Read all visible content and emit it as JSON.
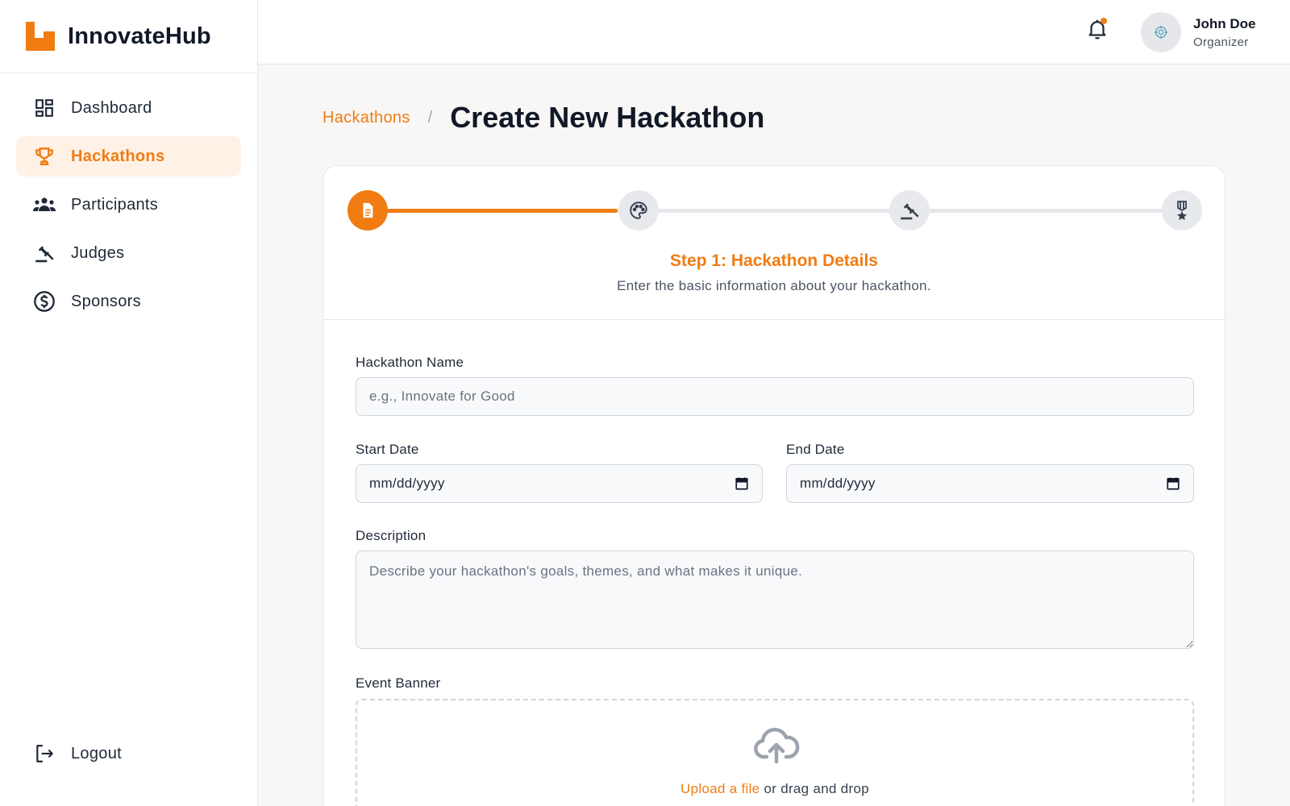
{
  "brand": {
    "name": "InnovateHub",
    "logo_icon": "innovatehub-logo-icon",
    "accent": "#f07c12"
  },
  "sidebar": {
    "items": [
      {
        "label": "Dashboard",
        "icon": "dashboard-icon",
        "active": false
      },
      {
        "label": "Hackathons",
        "icon": "trophy-icon",
        "active": true
      },
      {
        "label": "Participants",
        "icon": "groups-icon",
        "active": false
      },
      {
        "label": "Judges",
        "icon": "gavel-icon",
        "active": false
      },
      {
        "label": "Sponsors",
        "icon": "dollar-circle-icon",
        "active": false
      }
    ],
    "logout_label": "Logout"
  },
  "topbar": {
    "notification_icon": "bell-icon",
    "user": {
      "name": "John Doe",
      "role": "Organizer"
    }
  },
  "breadcrumb": {
    "parent": "Hackathons",
    "separator": "/",
    "current": "Create New Hackathon"
  },
  "stepper": {
    "steps": [
      {
        "icon": "document-icon",
        "active": true
      },
      {
        "icon": "palette-icon",
        "active": false
      },
      {
        "icon": "gavel-icon",
        "active": false
      },
      {
        "icon": "medal-icon",
        "active": false
      }
    ],
    "progress": 0.33,
    "title": "Step 1: Hackathon Details",
    "subtitle": "Enter the basic information about your hackathon."
  },
  "form": {
    "name_label": "Hackathon Name",
    "name_placeholder": "e.g., Innovate for Good",
    "start_label": "Start Date",
    "start_placeholder": "mm/dd/yyyy",
    "end_label": "End Date",
    "end_placeholder": "mm/dd/yyyy",
    "description_label": "Description",
    "description_placeholder": "Describe your hackathon's goals, themes, and what makes it unique.",
    "banner_label": "Event Banner",
    "upload_link": "Upload a file",
    "upload_rest": " or drag and drop"
  }
}
